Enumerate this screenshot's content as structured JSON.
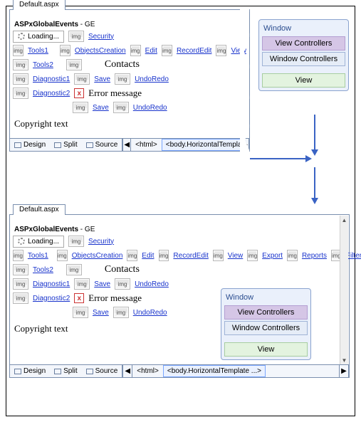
{
  "file_tab": "Default.aspx",
  "img_label": "img",
  "doc_title_bold": "ASPxGlobalEvents",
  "doc_title_suffix": " - GE",
  "loading_text": "Loading...",
  "links": {
    "security": "Security",
    "tools1": "Tools1",
    "tools2": "Tools2",
    "diag1": "Diagnostic1",
    "diag2": "Diagnostic2",
    "objc": "ObjectsCreation",
    "edit": "Edit",
    "rec": "RecordEdit",
    "view": "View",
    "export": "Export",
    "reports": "Reports",
    "filters": "Filters",
    "save": "Save",
    "undo": "UndoRedo"
  },
  "headings": {
    "contacts": "Contacts",
    "errmsg": "Error message"
  },
  "copyright": "Copyright text",
  "redbox_x": "x",
  "tabbar": {
    "design": "Design",
    "split": "Split",
    "source": "Source",
    "crumb1": "<html>",
    "crumb2": "<body.HorizontalTemplate ...>",
    "left": "◀",
    "right": "▶"
  },
  "window": {
    "title": "Window",
    "viewctrl": "View Controllers",
    "winctrl": "Window Controllers",
    "viewbtn": "View"
  },
  "scroll_up": "▲",
  "scroll_dn": "▼"
}
